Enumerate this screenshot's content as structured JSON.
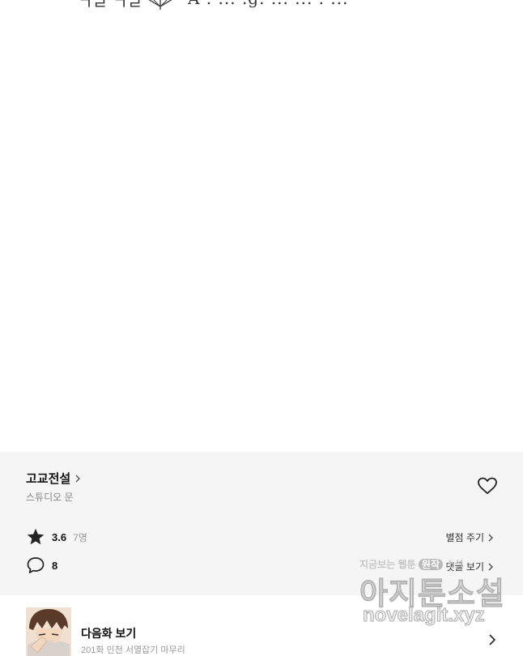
{
  "artwork": {
    "left_glyphs": "ㄱㄹ ㄱㄹ",
    "caption": "A . ... .g. ... ... . ..."
  },
  "info": {
    "title": "고교전설",
    "author": "스튜디오 문",
    "rating": {
      "score": "3.6",
      "voters": "7명",
      "rate_label": "별점 주기"
    },
    "comments": {
      "count": "8",
      "link_label": "댓글 보기"
    }
  },
  "next_episode": {
    "label": "다음화 보기",
    "subtitle": "201화 인천 서열잡기 마무리"
  },
  "watermark": {
    "prefix": "지금보는 웹툰",
    "highlight": "원작",
    "suffix": "소설",
    "brand": "아지툰소설",
    "url": "novelagit.xyz"
  },
  "colors": {
    "panel_bg": "#f5f5f5",
    "text_primary": "#111111",
    "text_secondary": "#888888"
  },
  "icons": [
    "star-icon",
    "comment-icon",
    "heart-icon",
    "chevron-right-icon",
    "umbrella-icon"
  ]
}
